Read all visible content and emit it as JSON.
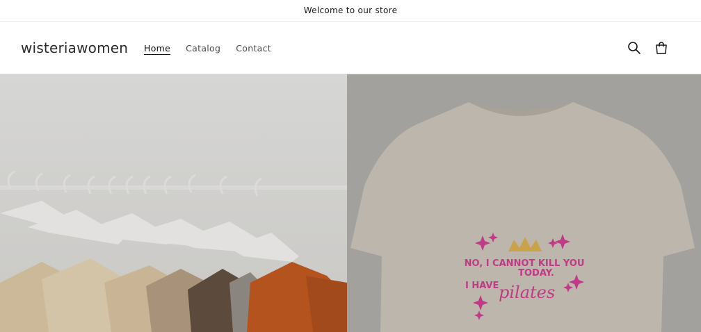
{
  "announcement": {
    "text": "Welcome to our store"
  },
  "header": {
    "logo": "wisteriawomen",
    "nav": [
      {
        "label": "Home",
        "active": true
      },
      {
        "label": "Catalog",
        "active": false
      },
      {
        "label": "Contact",
        "active": false
      }
    ],
    "icons": [
      "search-icon",
      "cart-icon"
    ]
  },
  "hero": {
    "left_image": "clothing-rack-with-hangers",
    "right_image": "pilates-tshirt",
    "tshirt_print": {
      "line1": "NO, I CANNOT KILL YOU",
      "line2": "TODAY.",
      "line3": "I HAVE",
      "script_word": "pilates"
    }
  },
  "colors": {
    "print_pink": "#c13a86",
    "crown_gold": "#c9a24a",
    "tshirt": "#bdb6ad",
    "orange_sweater": "#b5531f"
  }
}
